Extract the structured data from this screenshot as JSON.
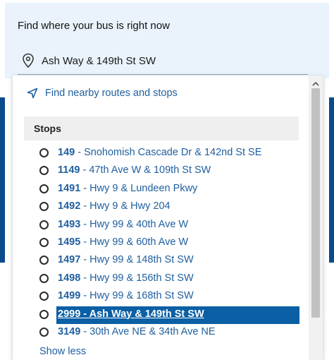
{
  "header": {
    "title": "Find where your bus is right now",
    "search_value": "Ash Way & 149th St SW"
  },
  "dropdown": {
    "nearby_label": "Find nearby routes and stops",
    "section_title": "Stops",
    "stops": [
      {
        "number": "149",
        "name": " - Snohomish Cascade Dr & 142nd St SE"
      },
      {
        "number": "1149",
        "name": " - 47th Ave W & 109th St SW"
      },
      {
        "number": "1491",
        "name": " - Hwy 9 & Lundeen Pkwy"
      },
      {
        "number": "1492",
        "name": " - Hwy 9 & Hwy 204"
      },
      {
        "number": "1493",
        "name": " - Hwy 99 & 40th Ave W"
      },
      {
        "number": "1495",
        "name": " - Hwy 99 & 60th Ave W"
      },
      {
        "number": "1497",
        "name": " - Hwy 99 & 148th St SW"
      },
      {
        "number": "1498",
        "name": " - Hwy 99 & 156th St SW"
      },
      {
        "number": "1499",
        "name": " - Hwy 99 & 168th St SW"
      },
      {
        "number": "2999",
        "name": " - Ash Way & 149th St SW"
      },
      {
        "number": "3149",
        "name": " - 30th Ave NE & 34th Ave NE"
      }
    ],
    "selected_stop": "2999",
    "show_less_label": "Show less"
  },
  "colors": {
    "link": "#1f5f9e",
    "highlight": "#0b5fa5",
    "header_bg": "#eaf3fb",
    "backdrop": "#0b4a8b"
  },
  "icons": {
    "search_field": "map-pin-icon",
    "nearby": "location-arrow-icon",
    "stop_item": "radio-circle-icon",
    "scroll": "chevron-up-icon"
  }
}
